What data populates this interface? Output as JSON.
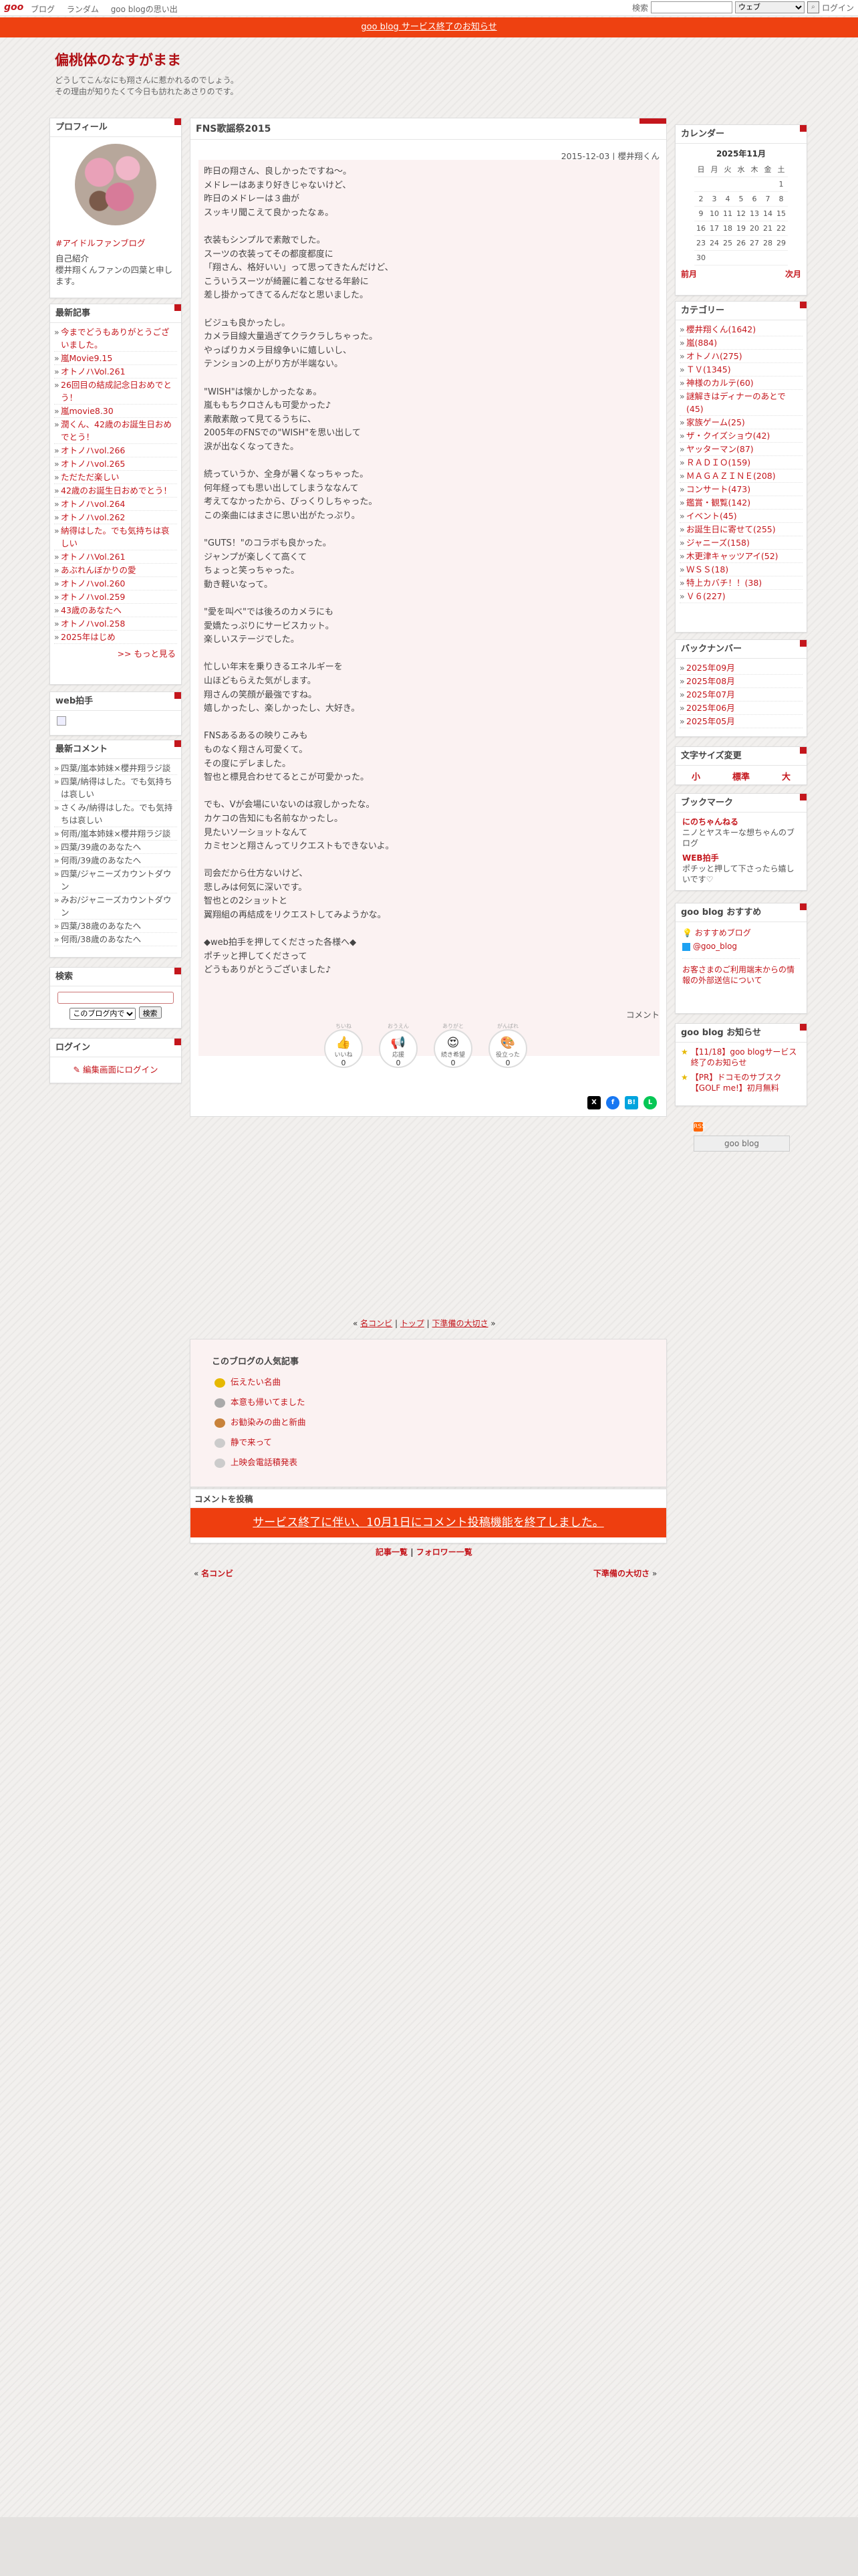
{
  "topbar": {
    "logo": "goo",
    "nav": [
      "ブログ",
      "ランダム",
      "goo blogの思い出"
    ],
    "search_label": "検索",
    "search_scope": "ウェブ",
    "login": "ログイン"
  },
  "notice": "goo blog サービス終了のお知らせ",
  "blog": {
    "title": "偏桃体のなすがまま",
    "desc1": "どうしてこんなにも翔さんに惹かれるのでしょう。",
    "desc2": "その理由が知りたくて今日も訪れたあさりのです。"
  },
  "profile": {
    "heading": "プロフィール",
    "tag": "#アイドルファンブログ",
    "intro_h": "自己紹介",
    "intro": "櫻井翔くんファンの四葉と申します。"
  },
  "recent": {
    "heading": "最新記事",
    "items": [
      "今までどうもありがとうございました。",
      "嵐Movie9.15",
      "オトノハVol.261",
      "26回目の結成記念日おめでとう！",
      "嵐movie8.30",
      "潤くん、42歳のお誕生日おめでとう！",
      "オトノハvol.266",
      "オトノハvol.265",
      "ただただ楽しい",
      "42歳のお誕生日おめでとう！",
      "オトノハvol.264",
      "オトノハvol.262",
      "納得はした。でも気持ちは哀しい",
      "オトノハVol.261",
      "あぶれんぼかりの愛",
      "オトノハvol.260",
      "オトノハvol.259",
      "43歳のあなたへ",
      "オトノハvol.258",
      "2025年はじめ"
    ],
    "more": ">> もっと見る"
  },
  "webclap": {
    "heading": "web拍手"
  },
  "comments": {
    "heading": "最新コメント",
    "items": [
      "四葉/嵐本姉妹×櫻井翔ラジ談",
      "四葉/納得はした。でも気持ちは哀しい",
      "さくみ/納得はした。でも気持ちは哀しい",
      "何雨/嵐本姉妹×櫻井翔ラジ談",
      "四葉/39歳のあなたへ",
      "何雨/39歳のあなたへ",
      "四葉/ジャニーズカウントダウン",
      "みお/ジャニーズカウントダウン",
      "四葉/38歳のあなたへ",
      "何雨/38歳のあなたへ"
    ]
  },
  "search": {
    "heading": "検索",
    "scope": "このブログ内で",
    "button": "検索"
  },
  "login": {
    "heading": "ログイン",
    "link": "編集画面にログイン"
  },
  "article": {
    "title": "FNS歌謡祭2015",
    "meta": "2015-12-03 | 櫻井翔くん",
    "body": "昨日の翔さん、良しかったですね〜。\nメドレーはあまり好きじゃないけど、\n昨日のメドレーは３曲が\nスッキリ聞こえて良かったなぁ。\n\n衣装もシンプルで素敵でした。\nスーツの衣装ってその都度都度に\n「翔さん、格好いい」って思ってきたんだけど、\nこういうスーツが綺麗に着こなせる年齢に\n差し掛かってきてるんだなと思いました。\n\nビジュも良かったし。\nカメラ目線大量過ぎてクラクラしちゃった。\nやっぱりカメラ目線争いに嬉しいし、\nテンションの上がり方が半端ない。\n\n\"WISH\"は懐かしかったなぁ。\n嵐ももちクロさんも可愛かった♪\n素敵素敵って見てるうちに、\n2005年のFNSでの\"WISH\"を思い出して\n涙が出なくなってきた。\n\n続っていうか、全身が暑くなっちゃった。\n何年経っても思い出してしまうななんて\n考えてなかったから、びっくりしちゃった。\nこの楽曲にはまさに思い出がたっぷり。\n\n\"GUTS！\"のコラボも良かった。\nジャンプが楽しくて高くて\nちょっと笑っちゃった。\n動き軽いなって。\n\n\"愛を叫べ\"では後ろのカメラにも\n愛嬌たっぷりにサービスカット。\n楽しいステージでした。\n\n忙しい年末を乗りきるエネルギーを\n山ほどもらえた気がします。\n翔さんの笑顔が最強ですね。\n嬉しかったし、楽しかったし、大好き。\n\nFNSあるあるの映りこみも\nものなく翔さん可愛くて。\nその度にデレました。\n智也と標見合わせてるとこが可愛かった。\n\nでも、Vが会場にいないのは寂しかったな。\nカケコの告知にも名前なかったし。\n見たいソーショットなんて\nカミセンと翔さんってリクエストもできないよ。\n\n司会だから仕方ないけど、\n悲しみは何気に深いです。\n智也との2ショットと\n翼翔組の再結成をリクエストしてみようかな。\n\n◆web拍手を押してくださった各様へ◆\nポチッと押してくださって\nどうもありがとうございました♪",
    "comment_label": "コメント",
    "reactions": [
      {
        "t": "ちいね",
        "g": "👍",
        "l": "いいね",
        "n": "0"
      },
      {
        "t": "おうえん",
        "g": "📢",
        "l": "応援",
        "n": "0"
      },
      {
        "t": "ありがと",
        "g": "😍",
        "l": "続き希望",
        "n": "0"
      },
      {
        "t": "がんばれ",
        "g": "🎨",
        "l": "役立った",
        "n": "0"
      }
    ]
  },
  "pager1": {
    "prev": "名コンビ",
    "mid": "トップ",
    "next": "下準備の大切さ"
  },
  "popular": {
    "heading": "このブログの人気記事",
    "items": [
      "伝えたい名曲",
      "本意も帰いてました",
      "お勧染みの曲と新曲",
      "静で来って",
      "上映会電話積発表"
    ]
  },
  "comment_post": {
    "heading": "コメントを投稿",
    "notice": "サービス終了に伴い、10月1日にコメント投稿機能を終了しました。"
  },
  "footlinks": {
    "a": "記事一覧",
    "b": "フォロワー一覧"
  },
  "pager2": {
    "prev": "名コンビ",
    "next": "下準備の大切さ"
  },
  "calendar": {
    "heading": "カレンダー",
    "month": "2025年11月",
    "dow": [
      "日",
      "月",
      "火",
      "水",
      "木",
      "金",
      "土"
    ],
    "weeks": [
      [
        "",
        "",
        "",
        "",
        "",
        "",
        "1"
      ],
      [
        "2",
        "3",
        "4",
        "5",
        "6",
        "7",
        "8"
      ],
      [
        "9",
        "10",
        "11",
        "12",
        "13",
        "14",
        "15"
      ],
      [
        "16",
        "17",
        "18",
        "19",
        "20",
        "21",
        "22"
      ],
      [
        "23",
        "24",
        "25",
        "26",
        "27",
        "28",
        "29"
      ],
      [
        "30",
        "",
        "",
        "",
        "",
        "",
        ""
      ]
    ],
    "prev": "前月",
    "next": "次月"
  },
  "categories": {
    "heading": "カテゴリー",
    "items": [
      "櫻井翔くん(1642)",
      "嵐(884)",
      "オトノハ(275)",
      "ＴＶ(1345)",
      "神様のカルテ(60)",
      "謎解きはディナーのあとで(45)",
      "家族ゲーム(25)",
      "ザ・クイズショウ(42)",
      "ヤッターマン(87)",
      "ＲＡＤＩＯ(159)",
      "ＭＡＧＡＺＩＮＥ(208)",
      "コンサート(473)",
      "鑑賞・観覧(142)",
      "イベント(45)",
      "お誕生日に寄せて(255)",
      "ジャニーズ(158)",
      "木更津キャッツアイ(52)",
      "ＷＳＳ(18)",
      "特上カバチ！！(38)",
      "Ｖ６(227)"
    ]
  },
  "backnumber": {
    "heading": "バックナンバー",
    "items": [
      "2025年09月",
      "2025年08月",
      "2025年07月",
      "2025年06月",
      "2025年05月"
    ]
  },
  "fontsize": {
    "heading": "文字サイズ変更",
    "s": "小",
    "m": "標準",
    "l": "大"
  },
  "bookmark": {
    "heading": "ブックマーク",
    "items": [
      {
        "t": "にのちゃんねる",
        "d": "ニノとヤスキーな想ちゃんのブログ"
      },
      {
        "t": "WEB拍手",
        "d": "ポチッと押して下さったら嬉しいです♡"
      }
    ]
  },
  "recommend": {
    "heading": "goo blog おすすめ",
    "a": "おすすめブログ",
    "b": "@goo_blog",
    "c": "お客さまのご利用端末からの情報の外部送信について"
  },
  "news": {
    "heading": "goo blog お知らせ",
    "items": [
      "【11/18】goo blogサービス終了のお知らせ",
      "【PR】ドコモのサブスク【GOLF me!】初月無料"
    ]
  },
  "footer_badge": "goo blog"
}
